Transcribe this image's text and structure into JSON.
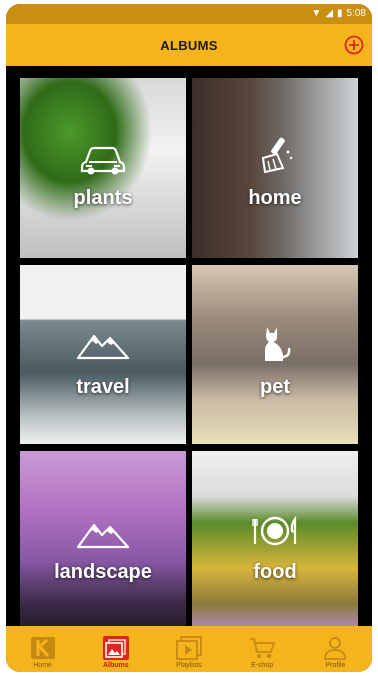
{
  "status": {
    "time": "5:08"
  },
  "header": {
    "title": "ALBUMS"
  },
  "albums": [
    {
      "label": "plants",
      "icon": "car-icon"
    },
    {
      "label": "home",
      "icon": "broom-icon"
    },
    {
      "label": "travel",
      "icon": "mountain-icon"
    },
    {
      "label": "pet",
      "icon": "cat-icon"
    },
    {
      "label": "landscape",
      "icon": "mountain-icon"
    },
    {
      "label": "food",
      "icon": "plate-icon"
    }
  ],
  "nav": [
    {
      "label": "Home",
      "icon": "kodak-logo-icon",
      "active": false
    },
    {
      "label": "Albums",
      "icon": "albums-icon",
      "active": true
    },
    {
      "label": "Playlists",
      "icon": "playlist-icon",
      "active": false
    },
    {
      "label": "E-shop",
      "icon": "cart-icon",
      "active": false
    },
    {
      "label": "Profile",
      "icon": "person-icon",
      "active": false
    }
  ],
  "colors": {
    "accent": "#f5b31c",
    "status_bar": "#c98f10",
    "active_nav": "#e0251b"
  }
}
